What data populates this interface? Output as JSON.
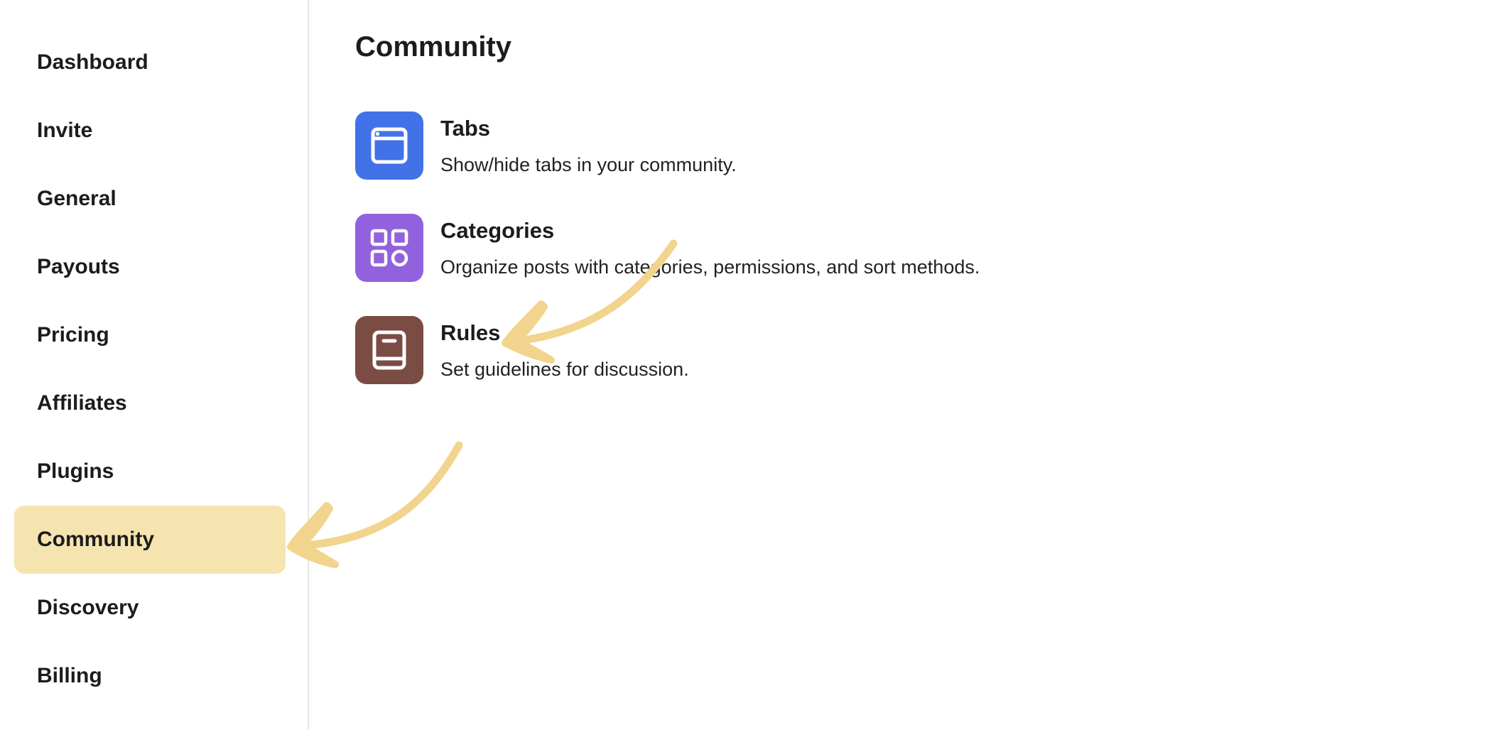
{
  "sidebar": {
    "items": [
      {
        "label": "Dashboard"
      },
      {
        "label": "Invite"
      },
      {
        "label": "General"
      },
      {
        "label": "Payouts"
      },
      {
        "label": "Pricing"
      },
      {
        "label": "Affiliates"
      },
      {
        "label": "Plugins"
      },
      {
        "label": "Community",
        "active": true
      },
      {
        "label": "Discovery"
      },
      {
        "label": "Billing"
      }
    ]
  },
  "main": {
    "title": "Community",
    "settings": [
      {
        "name": "Tabs",
        "description": "Show/hide tabs in your community.",
        "icon": "browser-window-icon",
        "color": "#4272e8"
      },
      {
        "name": "Categories",
        "description": "Organize posts with categories, permissions, and sort methods.",
        "icon": "grid-shapes-icon",
        "color": "#9262de"
      },
      {
        "name": "Rules",
        "description": "Set guidelines for discussion.",
        "icon": "book-icon",
        "color": "#7b4c44"
      }
    ]
  },
  "colors": {
    "active_highlight": "#f6e4b0",
    "annotation_arrow": "#f1d48d"
  }
}
